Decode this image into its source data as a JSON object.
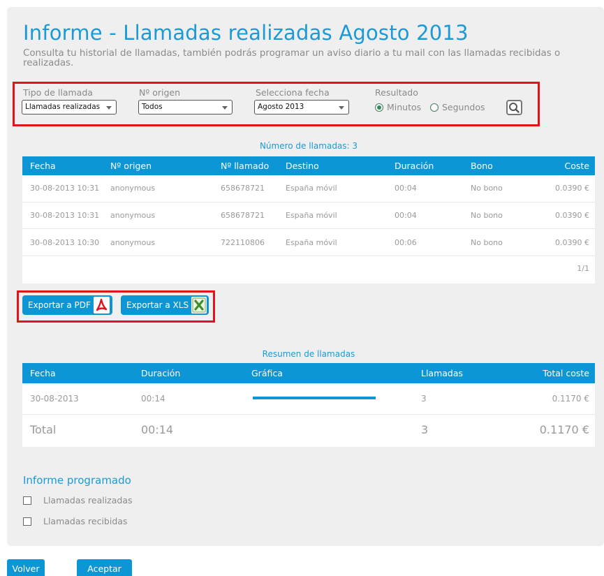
{
  "header": {
    "title": "Informe - Llamadas realizadas Agosto 2013",
    "subtitle": "Consulta tu historial de llamadas, también podrás programar un aviso diario a tu mail con las llamadas recibidas o realizadas."
  },
  "filters": {
    "tipo_label": "Tipo de llamada",
    "tipo_value": "Llamadas realizadas",
    "origen_label": "Nº origen",
    "origen_value": "Todos",
    "fecha_label": "Selecciona fecha",
    "fecha_value": "Agosto 2013",
    "resultado_label": "Resultado",
    "opt_minutos": "Minutos",
    "opt_segundos": "Segundos",
    "selected": "Minutos",
    "search_icon": "search-icon"
  },
  "calls": {
    "caption": "Número de llamadas: 3",
    "columns": [
      "Fecha",
      "Nº origen",
      "Nº llamado",
      "Destino",
      "Duración",
      "Bono",
      "Coste"
    ],
    "rows": [
      [
        "30-08-2013 10:31",
        "anonymous",
        "658678721",
        "España móvil",
        "00:04",
        "No bono",
        "0.0390 €"
      ],
      [
        "30-08-2013 10:31",
        "anonymous",
        "658678721",
        "España móvil",
        "00:04",
        "No bono",
        "0.0390 €"
      ],
      [
        "30-08-2013 10:30",
        "anonymous",
        "722110806",
        "España móvil",
        "00:06",
        "No bono",
        "0.0390 €"
      ]
    ],
    "pagination": "1/1"
  },
  "export": {
    "pdf_label": "Exportar a PDF",
    "xls_label": "Exportar a XLS",
    "pdf_icon": "pdf-icon",
    "xls_icon": "excel-icon"
  },
  "summary": {
    "caption": "Resumen de llamadas",
    "columns": [
      "Fecha",
      "Duración",
      "Gráfica",
      "Llamadas",
      "Total coste"
    ],
    "row": {
      "fecha": "30-08-2013",
      "duracion": "00:14",
      "bar_fraction": 1.0,
      "llamadas": "3",
      "coste": "0.1170 €"
    },
    "total": {
      "label": "Total",
      "duracion": "00:14",
      "llamadas": "3",
      "coste": "0.1170 €"
    }
  },
  "scheduled": {
    "title": "Informe programado",
    "option1": "Llamadas realizadas",
    "option2": "Llamadas recibidas"
  },
  "footer": {
    "volver": "Volver",
    "aceptar": "Aceptar"
  },
  "colors": {
    "accent": "#0d96d6",
    "highlight": "#e0151b",
    "panel": "#efefef"
  }
}
